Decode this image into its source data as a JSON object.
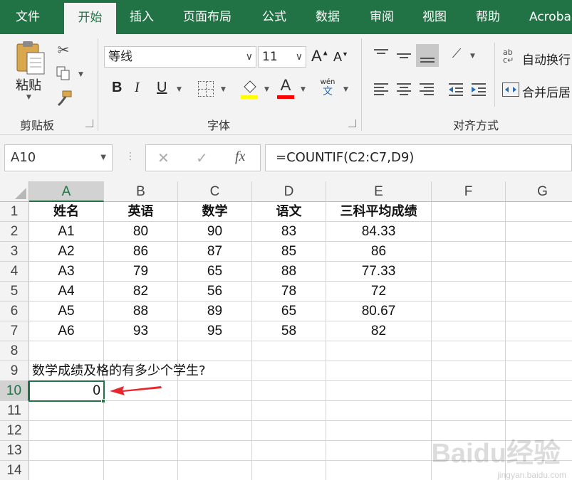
{
  "menu": {
    "tabs": [
      "文件",
      "开始",
      "插入",
      "页面布局",
      "公式",
      "数据",
      "审阅",
      "视图",
      "帮助",
      "Acroba"
    ],
    "active": "开始"
  },
  "ribbon": {
    "clipboard": {
      "paste_label": "粘贴",
      "group_label": "剪贴板"
    },
    "font": {
      "font_name": "等线",
      "font_size": "11",
      "grow": "A",
      "shrink": "A",
      "bold": "B",
      "italic": "I",
      "underline": "U",
      "font_color": "A",
      "phonetic_top": "wén",
      "phonetic_bottom": "文",
      "group_label": "字体"
    },
    "alignment": {
      "wrap_text": "自动换行",
      "merge_center": "合并后居",
      "group_label": "对齐方式"
    }
  },
  "formula_bar": {
    "name_box": "A10",
    "cancel": "✕",
    "enter": "✓",
    "fx": "fx",
    "formula": "=COUNTIF(C2:C7,D9)"
  },
  "sheet": {
    "columns": [
      "A",
      "B",
      "C",
      "D",
      "E",
      "F",
      "G"
    ],
    "rows": [
      "1",
      "2",
      "3",
      "4",
      "5",
      "6",
      "7",
      "8",
      "9",
      "10",
      "11",
      "12",
      "13",
      "14"
    ],
    "header": [
      "姓名",
      "英语",
      "数学",
      "语文",
      "三科平均成绩"
    ],
    "data": [
      [
        "A1",
        "80",
        "90",
        "83",
        "84.33"
      ],
      [
        "A2",
        "86",
        "87",
        "85",
        "86"
      ],
      [
        "A3",
        "79",
        "65",
        "88",
        "77.33"
      ],
      [
        "A4",
        "82",
        "56",
        "78",
        "72"
      ],
      [
        "A5",
        "88",
        "89",
        "65",
        "80.67"
      ],
      [
        "A6",
        "93",
        "95",
        "58",
        "82"
      ]
    ],
    "question": "数学成绩及格的有多少个学生?",
    "result": "0",
    "selected_cell": "A10"
  },
  "colors": {
    "excel_green": "#217346",
    "arrow_red": "#e8262b",
    "fill_yellow": "#ffff00",
    "font_red": "#ff0000"
  },
  "watermark": {
    "brand": "Baidu经验",
    "url": "jingyan.baidu.com"
  }
}
